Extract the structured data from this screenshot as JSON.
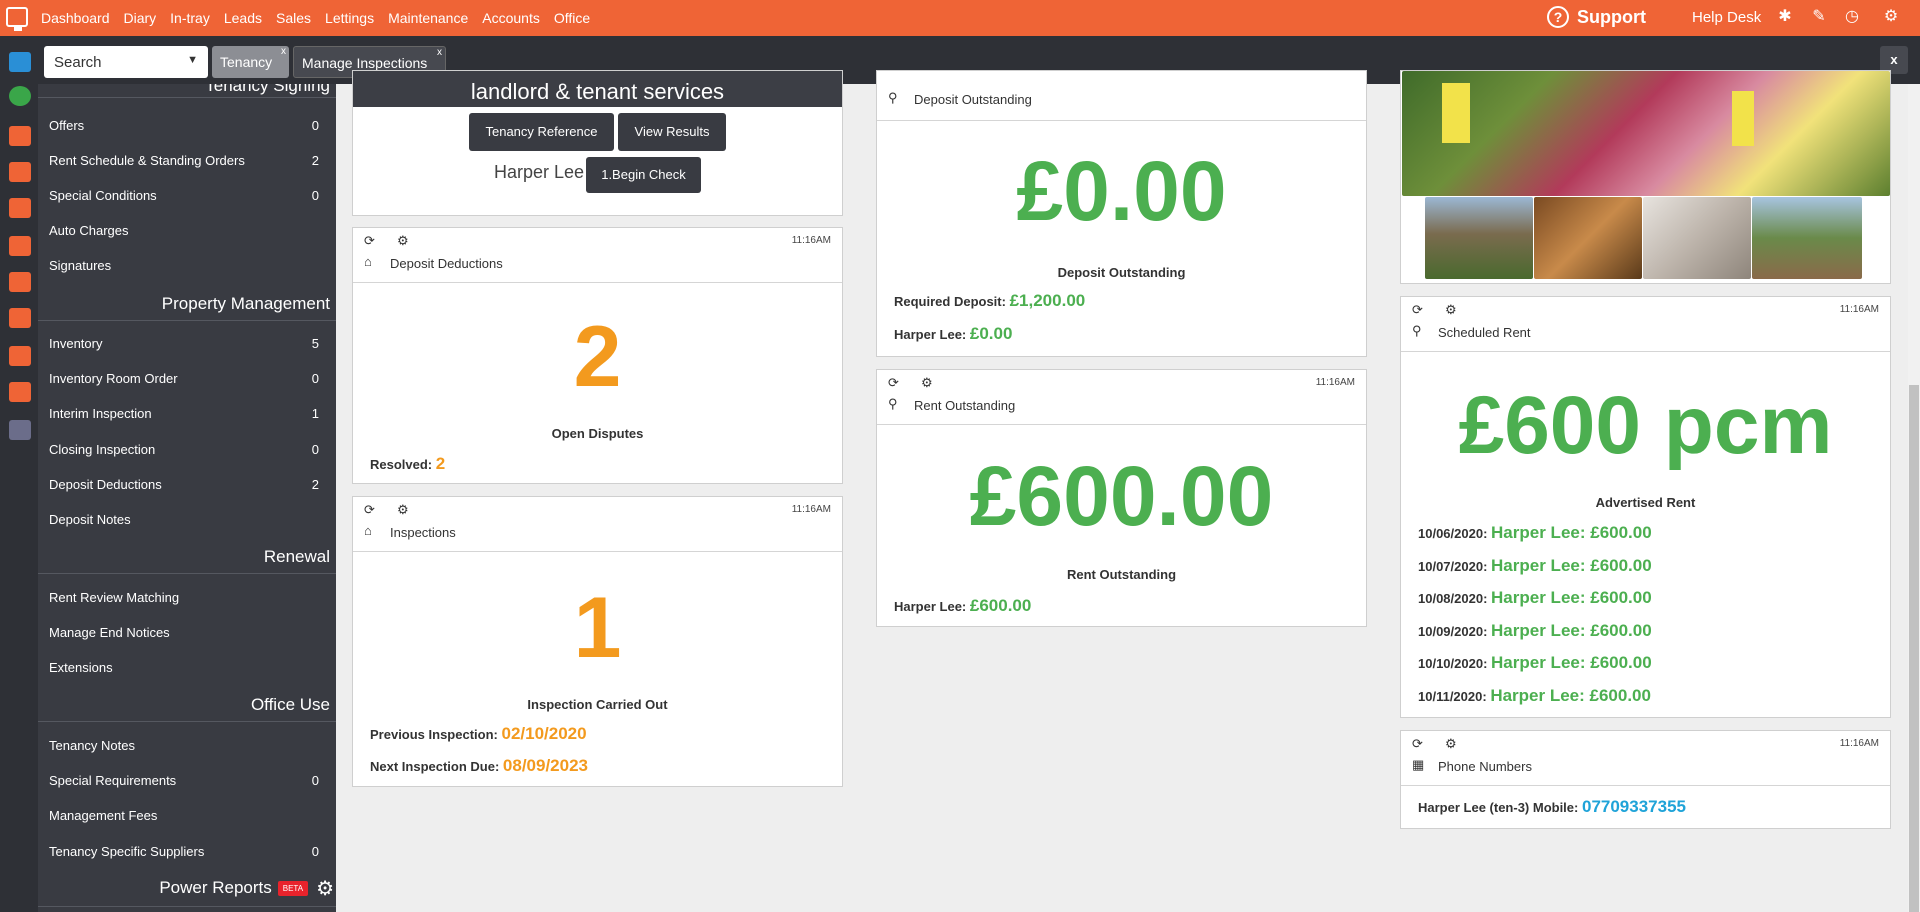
{
  "nav": {
    "items": [
      "Dashboard",
      "Diary",
      "In-tray",
      "Leads",
      "Sales",
      "Lettings",
      "Maintenance",
      "Accounts",
      "Office"
    ],
    "support": "Support",
    "help_desk": "Help Desk"
  },
  "tabbar": {
    "search_value": "Search",
    "tabs": [
      "Tenancy",
      "Manage Inspections"
    ],
    "tab_close": "x",
    "close": "x"
  },
  "sidebar": {
    "top_cut_heading": "Tenancy Signing",
    "tenancy_signing": [
      {
        "label": "Offers",
        "count": "0"
      },
      {
        "label": "Rent Schedule & Standing Orders",
        "count": "2"
      },
      {
        "label": "Special Conditions",
        "count": "0"
      },
      {
        "label": "Auto Charges",
        "count": ""
      },
      {
        "label": "Signatures",
        "count": ""
      }
    ],
    "property_management_heading": "Property Management",
    "property_management": [
      {
        "label": "Inventory",
        "count": "5"
      },
      {
        "label": "Inventory Room Order",
        "count": "0"
      },
      {
        "label": "Interim Inspection",
        "count": "1"
      },
      {
        "label": "Closing Inspection",
        "count": "0"
      },
      {
        "label": "Deposit Deductions",
        "count": "2"
      },
      {
        "label": "Deposit Notes",
        "count": ""
      }
    ],
    "renewal_heading": "Renewal",
    "renewal": [
      {
        "label": "Rent Review Matching",
        "count": ""
      },
      {
        "label": "Manage End Notices",
        "count": ""
      },
      {
        "label": "Extensions",
        "count": ""
      }
    ],
    "office_use_heading": "Office Use",
    "office_use": [
      {
        "label": "Tenancy Notes",
        "count": ""
      },
      {
        "label": "Special Requirements",
        "count": "0"
      },
      {
        "label": "Management Fees",
        "count": ""
      },
      {
        "label": "Tenancy Specific Suppliers",
        "count": "0"
      }
    ],
    "power_reports": "Power Reports",
    "beta": "BETA"
  },
  "ref_panel": {
    "banner": "landlord & tenant services",
    "tenancy_reference_btn": "Tenancy Reference",
    "view_results_btn": "View Results",
    "name": "Harper Lee",
    "begin_check_btn": "1.Begin Check"
  },
  "deposit_deductions": {
    "time": "11:16AM",
    "title": "Deposit Deductions",
    "value": "2",
    "caption": "Open Disputes",
    "resolved_label": "Resolved:",
    "resolved_value": "2"
  },
  "inspections": {
    "time": "11:16AM",
    "title": "Inspections",
    "value": "1",
    "caption": "Inspection Carried Out",
    "previous_label": "Previous Inspection:",
    "previous_value": "02/10/2020",
    "next_label": "Next Inspection Due:",
    "next_value": "08/09/2023"
  },
  "deposit_outstanding": {
    "title": "Deposit Outstanding",
    "value": "£0.00",
    "caption": "Deposit Outstanding",
    "required_label": "Required Deposit:",
    "required_value": "£1,200.00",
    "tenant_label": "Harper Lee:",
    "tenant_value": "£0.00"
  },
  "rent_outstanding": {
    "time": "11:16AM",
    "title": "Rent Outstanding",
    "value": "£600.00",
    "caption": "Rent Outstanding",
    "tenant_label": "Harper Lee:",
    "tenant_value": "£600.00"
  },
  "scheduled_rent": {
    "time": "11:16AM",
    "title": "Scheduled Rent",
    "value": "£600 pcm",
    "caption": "Advertised Rent",
    "rows": [
      {
        "date": "10/06/2020:",
        "amount": "Harper Lee: £600.00"
      },
      {
        "date": "10/07/2020:",
        "amount": "Harper Lee: £600.00"
      },
      {
        "date": "10/08/2020:",
        "amount": "Harper Lee: £600.00"
      },
      {
        "date": "10/09/2020:",
        "amount": "Harper Lee: £600.00"
      },
      {
        "date": "10/10/2020:",
        "amount": "Harper Lee: £600.00"
      },
      {
        "date": "10/11/2020:",
        "amount": "Harper Lee: £600.00"
      }
    ]
  },
  "phone_numbers": {
    "time": "11:16AM",
    "title": "Phone Numbers",
    "label": "Harper Lee (ten-3) Mobile:",
    "value": "07709337355"
  },
  "colors": {
    "nav_orange": "#ef6436",
    "value_green": "#4caf50",
    "value_orange": "#f39a1e",
    "phone_blue": "#1fa3d8"
  }
}
